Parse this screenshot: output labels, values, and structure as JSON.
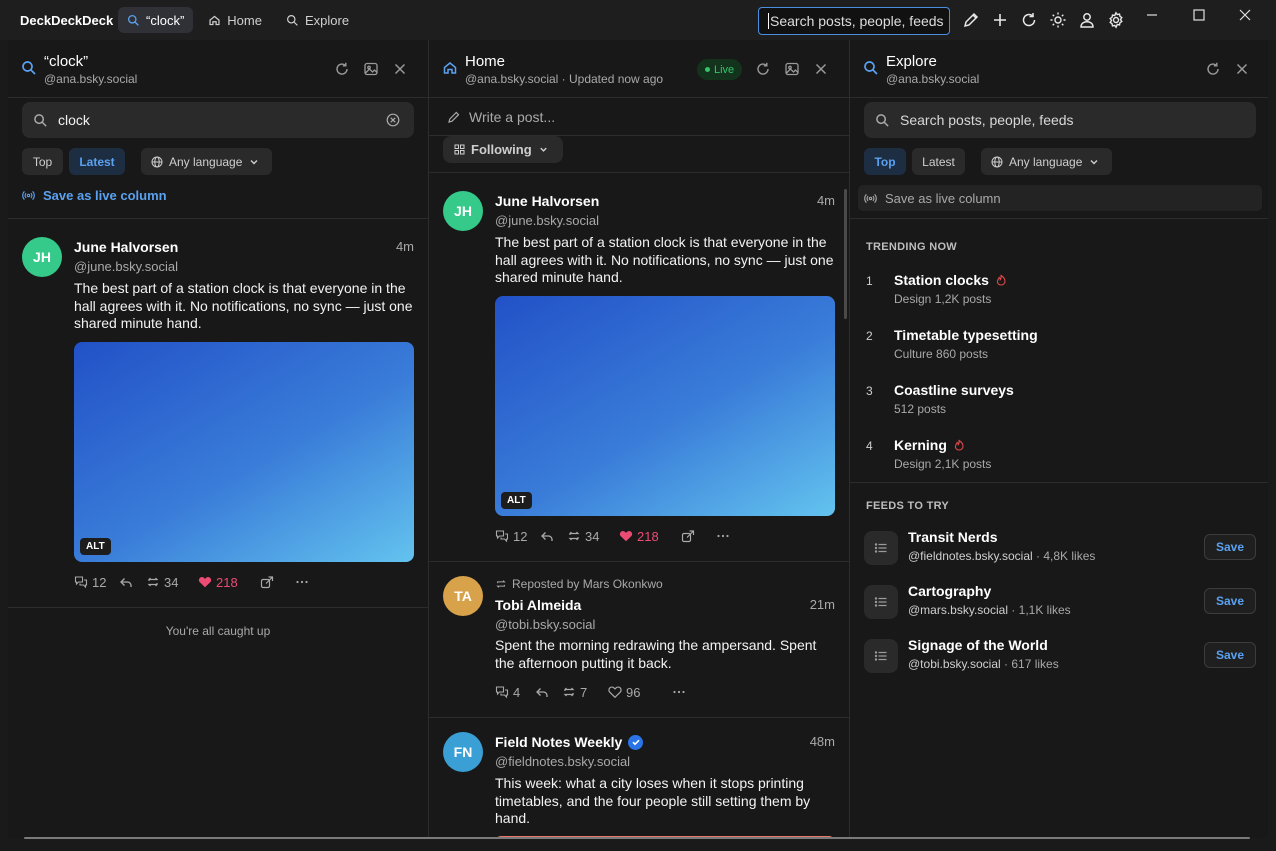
{
  "app": {
    "name": "DeckDeckDeck"
  },
  "titlebar": {
    "tabs": [
      {
        "label": "“clock”",
        "icon": "search-icon",
        "active": true
      },
      {
        "label": "Home",
        "icon": "home-icon",
        "active": false
      },
      {
        "label": "Explore",
        "icon": "search-icon",
        "active": false
      }
    ],
    "search_value": "Search posts, people, feeds",
    "actions": [
      "compose-icon",
      "plus-icon",
      "refresh-icon",
      "theme-icon",
      "profile-icon",
      "settings-icon"
    ],
    "window_controls": [
      "minimize-icon",
      "maximize-icon",
      "close-icon"
    ]
  },
  "columns": {
    "search": {
      "title": "“clock”",
      "account": "@ana.bsky.social",
      "query": "clock",
      "filters": {
        "top": "Top",
        "latest": "Latest",
        "active": "latest"
      },
      "language": "Any language",
      "save_live": "Save as live column",
      "posts": [
        {
          "initials": "JH",
          "avatar_color": "#35c98a",
          "name": "June Halvorsen",
          "handle": "@june.bsky.social",
          "time": "4m",
          "text": "The best part of a station clock is that everyone in the hall agrees with it. No notifications, no sync — just one shared minute hand.",
          "alt": "ALT",
          "replies": "12",
          "reposts": "34",
          "likes": "218"
        }
      ],
      "end_text": "You're all caught up"
    },
    "home": {
      "title": "Home",
      "subtitle": "@ana.bsky.social · Updated now ago",
      "live": "Live",
      "composer": "Write a post...",
      "feed": "Following",
      "posts": [
        {
          "initials": "JH",
          "avatar_color": "#35c98a",
          "name": "June Halvorsen",
          "handle": "@june.bsky.social",
          "time": "4m",
          "text": "The best part of a station clock is that everyone in the hall agrees with it. No notifications, no sync — just one shared minute hand.",
          "alt": "ALT",
          "replies": "12",
          "reposts": "34",
          "likes": "218"
        },
        {
          "initials": "TA",
          "avatar_color": "#d8a24a",
          "repost_by": "Reposted by Mars Okonkwo",
          "name": "Tobi Almeida",
          "handle": "@tobi.bsky.social",
          "time": "21m",
          "text": "Spent the morning redrawing the ampersand. Spent the afternoon putting it back.",
          "replies": "4",
          "reposts": "7",
          "likes": "96"
        },
        {
          "initials": "FN",
          "avatar_color": "#3a9fd4",
          "name": "Field Notes Weekly",
          "handle": "@fieldnotes.bsky.social",
          "time": "48m",
          "verified": true,
          "text": "This week: what a city loses when it stops printing timetables, and the four people still setting them by hand."
        }
      ]
    },
    "explore": {
      "title": "Explore",
      "account": "@ana.bsky.social",
      "search_placeholder": "Search posts, people, feeds",
      "filters": {
        "top": "Top",
        "latest": "Latest",
        "active": "top"
      },
      "language": "Any language",
      "save_live": "Save as live column",
      "trending_title": "TRENDING NOW",
      "trending": [
        {
          "rank": "1",
          "name": "Station clocks",
          "meta": "Design 1,2K posts",
          "hot": true
        },
        {
          "rank": "2",
          "name": "Timetable typesetting",
          "meta": "Culture 860 posts",
          "hot": false
        },
        {
          "rank": "3",
          "name": "Coastline surveys",
          "meta": "512 posts",
          "hot": false
        },
        {
          "rank": "4",
          "name": "Kerning",
          "meta": "Design 2,1K posts",
          "hot": true
        }
      ],
      "feeds_title": "FEEDS TO TRY",
      "feeds": [
        {
          "name": "Transit Nerds",
          "handle": "@fieldnotes.bsky.social",
          "likes": "· 4,8K likes",
          "save": "Save"
        },
        {
          "name": "Cartography",
          "handle": "@mars.bsky.social",
          "likes": "· 1,1K likes",
          "save": "Save"
        },
        {
          "name": "Signage of the World",
          "handle": "@tobi.bsky.social",
          "likes": "· 617 likes",
          "save": "Save"
        }
      ]
    }
  },
  "colors": {
    "accent": "#5aa1f0",
    "like": "#ec4b73",
    "live": "#34c46a",
    "background": "#181818"
  }
}
